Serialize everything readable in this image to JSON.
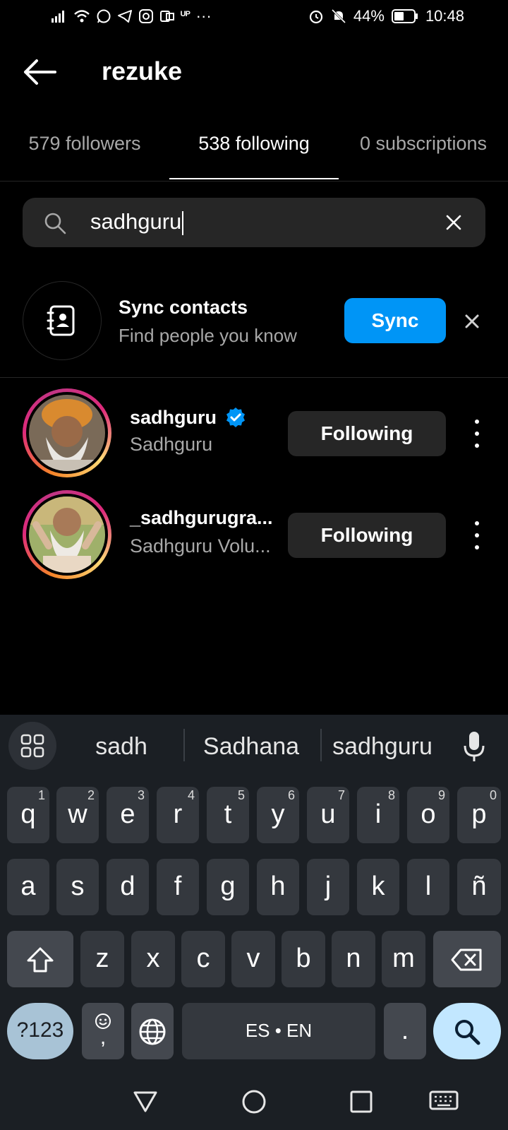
{
  "status_bar": {
    "battery": "44%",
    "time": "10:48"
  },
  "header": {
    "title": "rezuke"
  },
  "tabs": [
    {
      "label": "579 followers"
    },
    {
      "label": "538 following"
    },
    {
      "label": "0 subscriptions"
    }
  ],
  "search": {
    "value": "sadhguru"
  },
  "sync": {
    "title": "Sync contacts",
    "subtitle": "Find people you know",
    "button": "Sync"
  },
  "results": [
    {
      "username": "sadhguru",
      "full_name": "Sadhguru",
      "verified": true,
      "button": "Following"
    },
    {
      "username": "_sadhgurugra...",
      "full_name": "Sadhguru Volu...",
      "verified": false,
      "button": "Following"
    }
  ],
  "keyboard": {
    "suggestions": [
      "sadh",
      "Sadhana",
      "sadhguru"
    ],
    "row1": [
      {
        "k": "q",
        "h": "1"
      },
      {
        "k": "w",
        "h": "2"
      },
      {
        "k": "e",
        "h": "3"
      },
      {
        "k": "r",
        "h": "4"
      },
      {
        "k": "t",
        "h": "5"
      },
      {
        "k": "y",
        "h": "6"
      },
      {
        "k": "u",
        "h": "7"
      },
      {
        "k": "i",
        "h": "8"
      },
      {
        "k": "o",
        "h": "9"
      },
      {
        "k": "p",
        "h": "0"
      }
    ],
    "row2": [
      "a",
      "s",
      "d",
      "f",
      "g",
      "h",
      "j",
      "k",
      "l",
      "ñ"
    ],
    "row3": [
      "z",
      "x",
      "c",
      "v",
      "b",
      "n",
      "m"
    ],
    "symbols_key": "?123",
    "emoji_comma": ",",
    "space_label": "ES • EN",
    "period": "."
  },
  "colors": {
    "accent": "#0095f6",
    "keyboard_bg": "#1b1f24",
    "key_bg": "#34383e",
    "search_key_bg": "#c2e7ff",
    "symbols_key_bg": "#a8c3d6"
  }
}
